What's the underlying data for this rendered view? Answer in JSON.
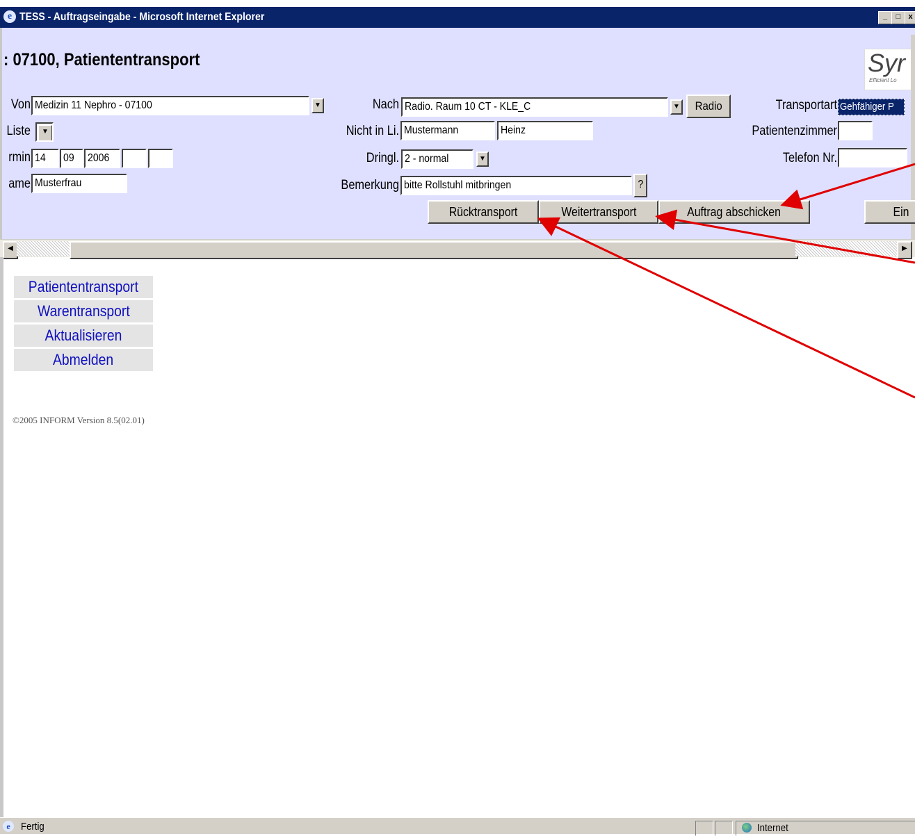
{
  "window": {
    "title": "TESS - Auftragseingabe - Microsoft Internet Explorer",
    "buttons": [
      "_",
      "□",
      "x"
    ]
  },
  "form": {
    "heading": ": 07100, Patiententransport",
    "logo_text": "Syr",
    "logo_tagline": "Efficient Lo",
    "von": {
      "label": "Von",
      "value": "Medizin 11 Nephro - 07100"
    },
    "liste": {
      "label": "Liste"
    },
    "termin": {
      "label": "rmin",
      "day": "14",
      "month": "09",
      "year": "2006",
      "hour": "",
      "minute": ""
    },
    "name": {
      "label": "ame",
      "value": "Musterfrau"
    },
    "nach": {
      "label": "Nach",
      "value": "Radio. Raum 10 CT - KLE_C",
      "button": "Radio"
    },
    "nicht_in_liste": {
      "label": "Nicht in Li.",
      "lastname": "Mustermann",
      "firstname": "Heinz"
    },
    "dringl": {
      "label": "Dringl.",
      "value": "2 - normal"
    },
    "bemerkung": {
      "label": "Bemerkung",
      "value": "bitte Rollstuhl mitbringen",
      "help": "?"
    },
    "transportart": {
      "label": "Transportart",
      "value": "Gehfähiger P"
    },
    "patientenzimmer": {
      "label": "Patientenzimmer",
      "value": ""
    },
    "telefon": {
      "label": "Telefon Nr.",
      "value": ""
    },
    "buttons": {
      "rueck": "Rücktransport",
      "weiter": "Weitertransport",
      "abschicken": "Auftrag abschicken",
      "ein": "Ein"
    }
  },
  "nav": [
    "Patiententransport",
    "Warentransport",
    "Aktualisieren",
    "Abmelden"
  ],
  "copyright": "©2005 INFORM Version 8.5(02.01)",
  "status": {
    "left": "Fertig",
    "zone": "Internet"
  },
  "colors": {
    "titlebar": "#0a246a",
    "form_bg": "#dfe0ff",
    "arrow": "#e00000"
  }
}
